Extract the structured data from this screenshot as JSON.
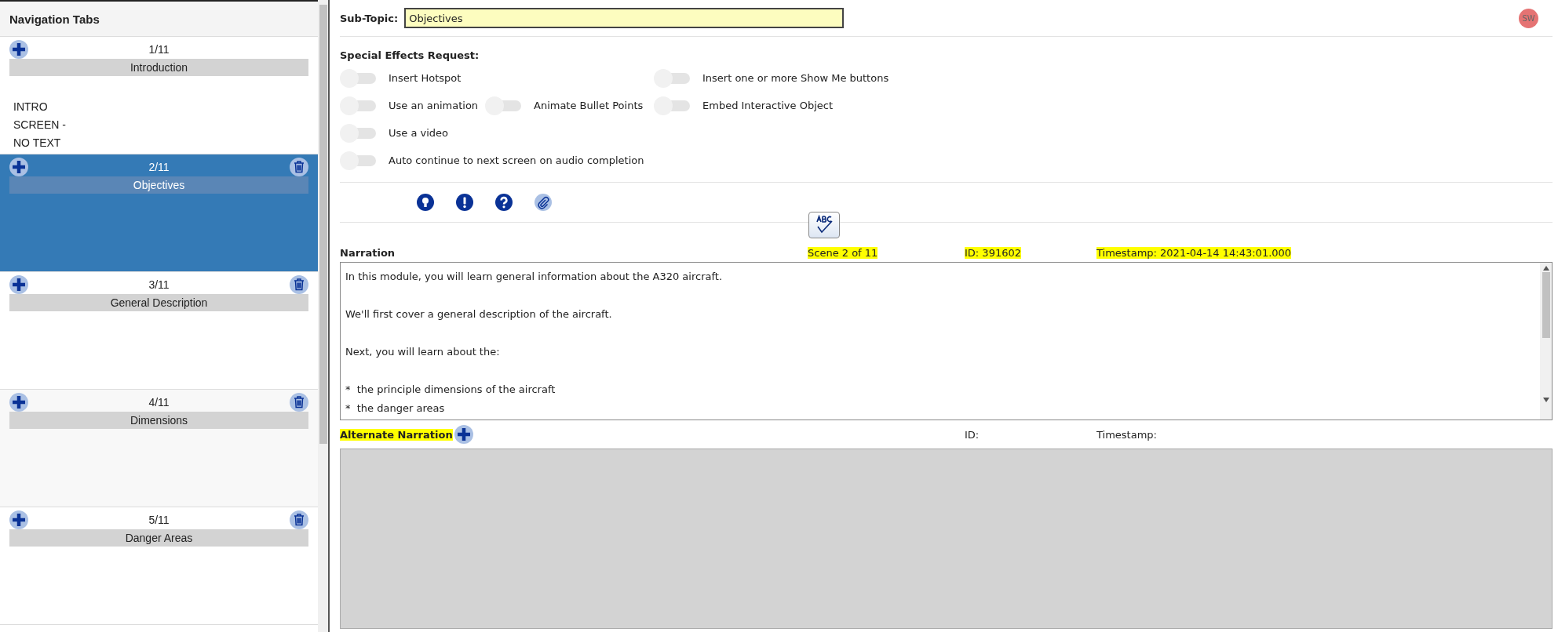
{
  "sidebar": {
    "title": "Navigation Tabs",
    "items": [
      {
        "counter": "1/11",
        "title": "Introduction",
        "note": "INTRO SCREEN - NO TEXT",
        "selected": false,
        "deletable": false
      },
      {
        "counter": "2/11",
        "title": "Objectives",
        "selected": true,
        "deletable": true
      },
      {
        "counter": "3/11",
        "title": "General Description",
        "selected": false,
        "deletable": true
      },
      {
        "counter": "4/11",
        "title": "Dimensions",
        "selected": false,
        "deletable": true
      },
      {
        "counter": "5/11",
        "title": "Danger Areas",
        "selected": false,
        "deletable": true
      }
    ]
  },
  "sub_topic": {
    "label": "Sub-Topic:",
    "value": "Objectives"
  },
  "user": {
    "initials": "SW"
  },
  "special_effects": {
    "title": "Special Effects Request:",
    "rows": [
      [
        {
          "label": "Insert Hotspot",
          "on": false
        },
        null,
        {
          "label": "Insert one or more Show Me buttons",
          "on": false
        }
      ],
      [
        {
          "label": "Use an animation",
          "on": false
        },
        {
          "label": "Animate Bullet Points",
          "on": false
        },
        {
          "label": "Embed Interactive Object",
          "on": false
        }
      ],
      [
        {
          "label": "Use a video",
          "on": false
        }
      ],
      [
        {
          "label": "Auto continue to next screen on audio completion",
          "on": false
        }
      ]
    ]
  },
  "tool_icons": [
    {
      "kind": "bulb",
      "active": false
    },
    {
      "kind": "alert",
      "active": false
    },
    {
      "kind": "help",
      "active": false
    },
    {
      "kind": "attach",
      "active": true
    }
  ],
  "narration": {
    "label": "Narration",
    "scene": {
      "text": "Scene 2 of 11",
      "highlighted": true
    },
    "id": {
      "text": "ID: 391602",
      "highlighted": true
    },
    "timestamp": {
      "text": "Timestamp: 2021-04-14 14:43:01.000",
      "highlighted": true
    },
    "lines": [
      {
        "kind": "paragraph",
        "text": "In this module, you will learn general information about the A320 aircraft."
      },
      {
        "kind": "paragraph",
        "text": "We'll first cover a general description of the aircraft."
      },
      {
        "kind": "paragraph",
        "text": "Next, you will learn about the:"
      },
      {
        "kind": "bullet",
        "text": "*  the principle dimensions of the aircraft"
      },
      {
        "kind": "bullet",
        "text": "*  the danger areas"
      }
    ]
  },
  "alternate_narration": {
    "label": {
      "text": "Alternate Narration",
      "highlighted": true
    },
    "id": {
      "text": "ID:",
      "highlighted": false
    },
    "timestamp": {
      "text": "Timestamp:",
      "highlighted": false
    }
  }
}
